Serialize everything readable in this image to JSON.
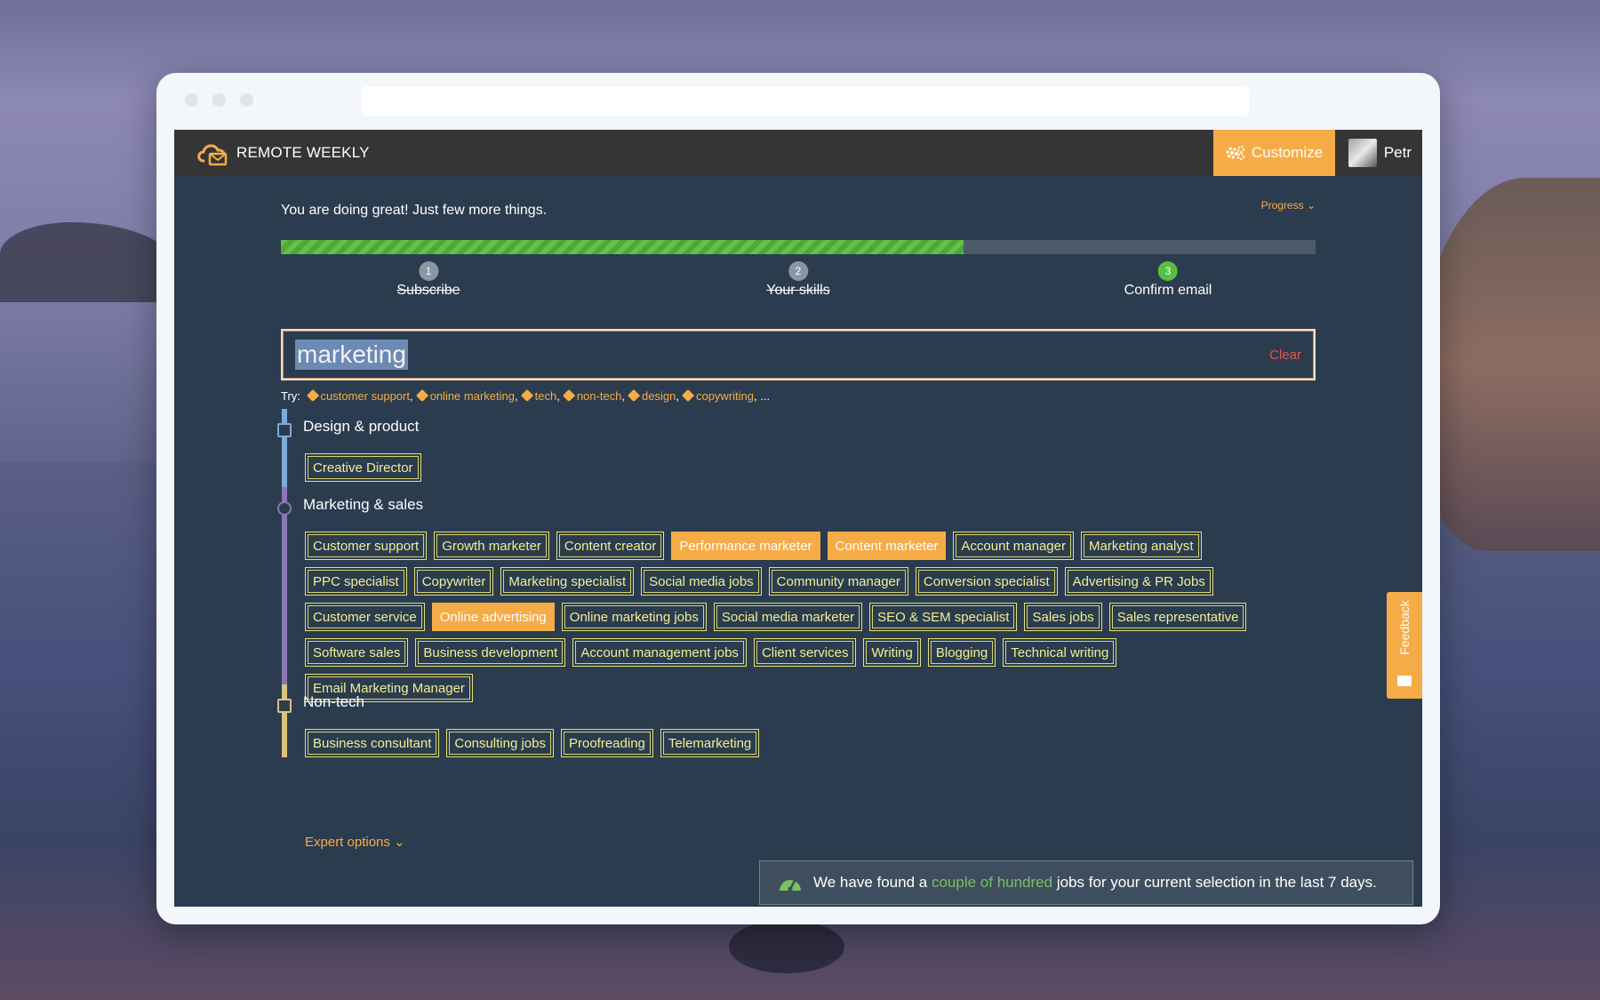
{
  "app": {
    "brand": "REMOTE WEEKLY",
    "customize_label": "Customize",
    "user_name": "Petr"
  },
  "progress": {
    "intro": "You are doing great! Just few more things.",
    "toggle_label": "Progress",
    "fill_fraction": 0.66,
    "steps": [
      {
        "num": "1",
        "label": "Subscribe",
        "state": "done"
      },
      {
        "num": "2",
        "label": "Your skills",
        "state": "done"
      },
      {
        "num": "3",
        "label": "Confirm email",
        "state": "active"
      }
    ]
  },
  "search": {
    "value": "marketing",
    "clear_label": "Clear",
    "try_label": "Try:",
    "suggestions": [
      "customer support",
      "online marketing",
      "tech",
      "non-tech",
      "design",
      "copywriting"
    ],
    "ellipsis": "..."
  },
  "categories": [
    {
      "title": "Design & product",
      "icon": "monitor-icon",
      "color": "#7fa9d9",
      "chips": [
        {
          "label": "Creative Director",
          "selected": false
        }
      ]
    },
    {
      "title": "Marketing & sales",
      "icon": "pie-chart-icon",
      "color": "#8a78b5",
      "chips": [
        {
          "label": "Customer support",
          "selected": false
        },
        {
          "label": "Growth marketer",
          "selected": false
        },
        {
          "label": "Content creator",
          "selected": false
        },
        {
          "label": "Performance marketer",
          "selected": true
        },
        {
          "label": "Content marketer",
          "selected": true
        },
        {
          "label": "Account manager",
          "selected": false
        },
        {
          "label": "Marketing analyst",
          "selected": false
        },
        {
          "label": "PPC specialist",
          "selected": false
        },
        {
          "label": "Copywriter",
          "selected": false
        },
        {
          "label": "Marketing specialist",
          "selected": false
        },
        {
          "label": "Social media jobs",
          "selected": false
        },
        {
          "label": "Community manager",
          "selected": false
        },
        {
          "label": "Conversion specialist",
          "selected": false
        },
        {
          "label": "Advertising & PR Jobs",
          "selected": false
        },
        {
          "label": "Customer service",
          "selected": false
        },
        {
          "label": "Online advertising",
          "selected": true
        },
        {
          "label": "Online marketing jobs",
          "selected": false
        },
        {
          "label": "Social media marketer",
          "selected": false
        },
        {
          "label": "SEO & SEM specialist",
          "selected": false
        },
        {
          "label": "Sales jobs",
          "selected": false
        },
        {
          "label": "Sales representative",
          "selected": false
        },
        {
          "label": "Software sales",
          "selected": false
        },
        {
          "label": "Business development",
          "selected": false
        },
        {
          "label": "Account management jobs",
          "selected": false
        },
        {
          "label": "Client services",
          "selected": false
        },
        {
          "label": "Writing",
          "selected": false
        },
        {
          "label": "Blogging",
          "selected": false
        },
        {
          "label": "Technical writing",
          "selected": false
        },
        {
          "label": "Email Marketing Manager",
          "selected": false
        }
      ]
    },
    {
      "title": "Non-tech",
      "icon": "paperclip-icon",
      "color": "#d9c27a",
      "chips": [
        {
          "label": "Business consultant",
          "selected": false
        },
        {
          "label": "Consulting jobs",
          "selected": false
        },
        {
          "label": "Proofreading",
          "selected": false
        },
        {
          "label": "Telemarketing",
          "selected": false
        }
      ]
    }
  ],
  "expert_options_label": "Expert options",
  "feedback_label": "Feedback",
  "toast": {
    "prefix": "We have found a",
    "highlight": "couple of hundred",
    "suffix": "jobs for your current selection in the last 7 days."
  }
}
